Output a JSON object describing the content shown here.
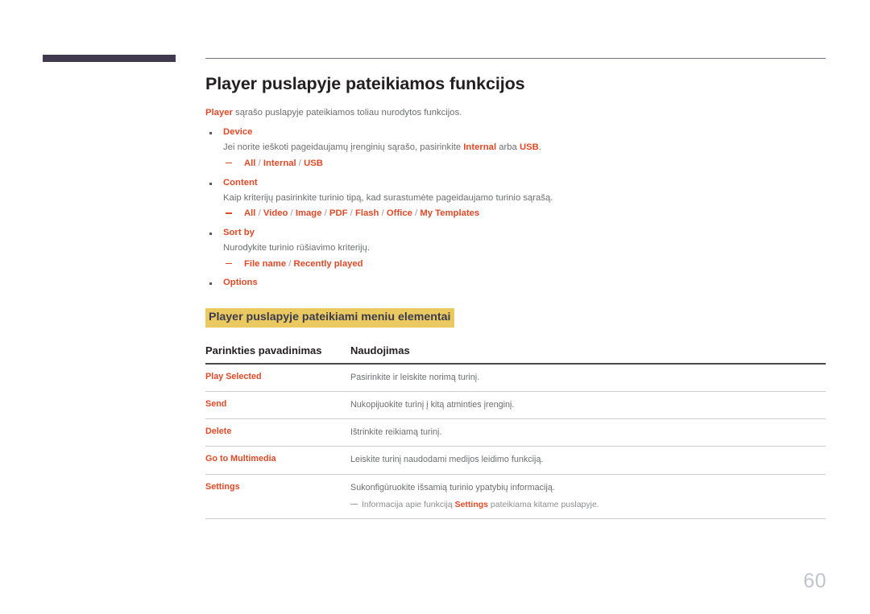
{
  "header": {
    "bar_color": "#413A4F",
    "rule_color": "#6F7277"
  },
  "page": {
    "title": "Player puslapyje pateikiamos funkcijos",
    "intro_keyword": "Player",
    "intro_rest": " sąrašo puslapyje pateikiamos toliau nurodytos funkcijos.",
    "page_number": "60",
    "accent_color": "#E04927",
    "highlight_color": "#EAC961",
    "highlight_text_color": "#3B3B4E"
  },
  "features": [
    {
      "title": "Device",
      "desc_prefix": "Jei norite ieškoti pageidaujamų įrenginių sąrašo, pasirinkite ",
      "desc_kw1": "Internal",
      "desc_mid": " arba ",
      "desc_kw2": "USB",
      "desc_suffix": ".",
      "options": [
        "All",
        "Internal",
        "USB"
      ],
      "option_separator": " / "
    },
    {
      "title": "Content",
      "desc_prefix": "Kaip kriterijų pasirinkite turinio tipą, kad surastumėte pageidaujamo turinio sąrašą.",
      "options": [
        "All",
        "Video",
        "Image",
        "PDF",
        "Flash",
        "Office",
        "My Templates"
      ],
      "option_separator": " / "
    },
    {
      "title": "Sort by",
      "desc_prefix": "Nurodykite turinio rūšiavimo kriterijų.",
      "options": [
        "File name",
        "Recently played"
      ],
      "option_separator": " / "
    },
    {
      "title": "Options",
      "desc_prefix": "",
      "options": [],
      "option_separator": " / "
    }
  ],
  "menu_section": {
    "heading": "Player puslapyje pateikiami meniu elementai",
    "table": {
      "columns": [
        "Parinkties pavadinimas",
        "Naudojimas"
      ],
      "rows": [
        {
          "name": "Play Selected",
          "use": "Pasirinkite ir leiskite norimą turinį.",
          "note": null
        },
        {
          "name": "Send",
          "use": "Nukopijuokite turinį į kitą atminties įrenginį.",
          "note": null
        },
        {
          "name": "Delete",
          "use": "Ištrinkite reikiamą turinį.",
          "note": null
        },
        {
          "name": "Go to Multimedia",
          "use": "Leiskite turinį naudodami medijos leidimo funkciją.",
          "note": null
        },
        {
          "name": "Settings",
          "use": "Sukonfigūruokite išsamią turinio ypatybių informaciją.",
          "note": {
            "prefix": "Informacija apie funkciją ",
            "keyword": "Settings",
            "suffix": " pateikiama kitame puslapyje."
          }
        }
      ]
    }
  }
}
